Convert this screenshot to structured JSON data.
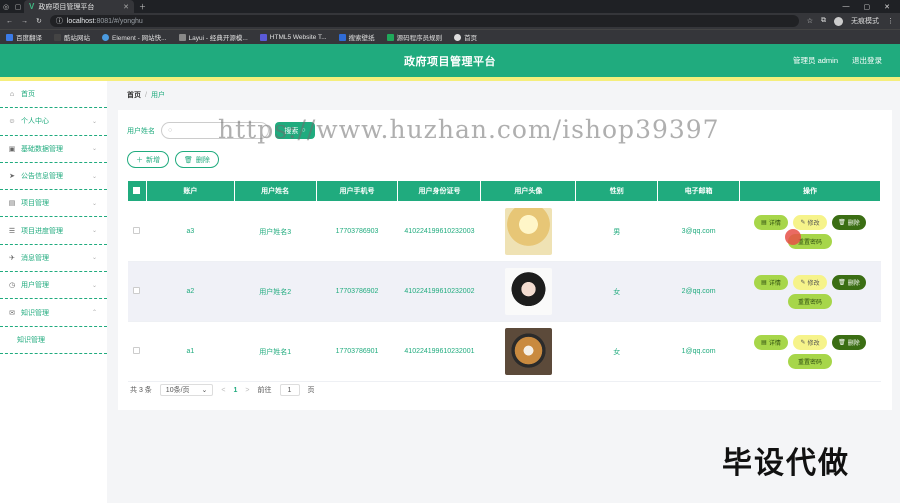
{
  "browser": {
    "tab_title": "政府项目管理平台",
    "url_host": "localhost",
    "url_rest": ":8081/#/yonghu",
    "profile_label": "无痕模式",
    "bookmarks": [
      "百度翻译",
      "酷站网站",
      "Element - 网站快...",
      "Layui - 经典开源模...",
      "HTML5 Website T...",
      "搜索壁纸",
      "源码程序员规则",
      "首页"
    ]
  },
  "header": {
    "title": "政府项目管理平台",
    "user": "管理员 admin",
    "logout": "退出登录"
  },
  "sidebar": {
    "items": [
      {
        "label": "首页",
        "icon": "home-icon"
      },
      {
        "label": "个人中心",
        "icon": "user-icon"
      },
      {
        "label": "基础数据管理",
        "icon": "box-icon"
      },
      {
        "label": "公告信息管理",
        "icon": "send-icon"
      },
      {
        "label": "项目管理",
        "icon": "doc-icon"
      },
      {
        "label": "项目进度管理",
        "icon": "list-icon"
      },
      {
        "label": "消息管理",
        "icon": "paper-plane-icon"
      },
      {
        "label": "用户管理",
        "icon": "clock-icon"
      },
      {
        "label": "知识管理",
        "icon": "mail-icon"
      },
      {
        "label": "知识管理",
        "icon": ""
      }
    ]
  },
  "breadcrumb": {
    "home": "首页",
    "sep": "/",
    "current": "用户"
  },
  "search": {
    "label": "用户姓名",
    "placeholder": "",
    "button": "搜索"
  },
  "actions": {
    "add": "新增",
    "delete": "删除"
  },
  "table": {
    "columns": [
      "账户",
      "用户姓名",
      "用户手机号",
      "用户身份证号",
      "用户头像",
      "性别",
      "电子邮箱",
      "操作"
    ],
    "rows": [
      {
        "account": "a3",
        "name": "用户姓名3",
        "phone": "17703786903",
        "idcard": "410224199610232003",
        "gender": "男",
        "email": "3@qq.com"
      },
      {
        "account": "a2",
        "name": "用户姓名2",
        "phone": "17703786902",
        "idcard": "410224199610232002",
        "gender": "女",
        "email": "2@qq.com"
      },
      {
        "account": "a1",
        "name": "用户姓名1",
        "phone": "17703786901",
        "idcard": "410224199610232001",
        "gender": "女",
        "email": "1@qq.com"
      }
    ],
    "ops": {
      "detail": "详情",
      "edit": "修改",
      "del": "删除",
      "reset": "重置密码"
    }
  },
  "pager": {
    "total": "共 3 条",
    "size": "10条/页",
    "prev": "<",
    "page": "1",
    "next": ">",
    "goto": "前往",
    "jump_value": "1",
    "page_unit": "页"
  },
  "watermark": "https://www.huzhan.com/ishop39397",
  "corner_text": "毕设代做",
  "colors": {
    "primary": "#20ab7e",
    "accent_yellow": "#f5ee7c"
  }
}
